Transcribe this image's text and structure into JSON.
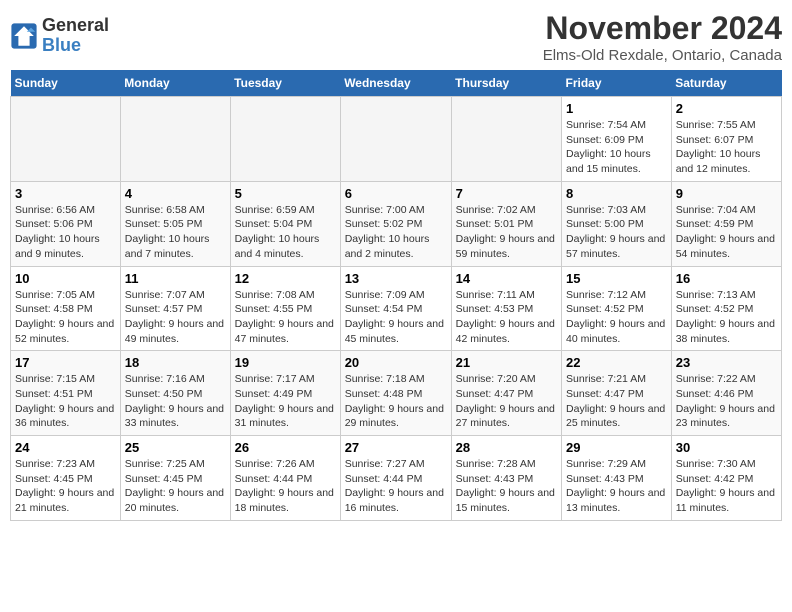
{
  "header": {
    "logo_text_general": "General",
    "logo_text_blue": "Blue",
    "month_title": "November 2024",
    "location": "Elms-Old Rexdale, Ontario, Canada"
  },
  "days_of_week": [
    "Sunday",
    "Monday",
    "Tuesday",
    "Wednesday",
    "Thursday",
    "Friday",
    "Saturday"
  ],
  "weeks": [
    [
      {
        "day": "",
        "info": ""
      },
      {
        "day": "",
        "info": ""
      },
      {
        "day": "",
        "info": ""
      },
      {
        "day": "",
        "info": ""
      },
      {
        "day": "",
        "info": ""
      },
      {
        "day": "1",
        "info": "Sunrise: 7:54 AM\nSunset: 6:09 PM\nDaylight: 10 hours and 15 minutes."
      },
      {
        "day": "2",
        "info": "Sunrise: 7:55 AM\nSunset: 6:07 PM\nDaylight: 10 hours and 12 minutes."
      }
    ],
    [
      {
        "day": "3",
        "info": "Sunrise: 6:56 AM\nSunset: 5:06 PM\nDaylight: 10 hours and 9 minutes."
      },
      {
        "day": "4",
        "info": "Sunrise: 6:58 AM\nSunset: 5:05 PM\nDaylight: 10 hours and 7 minutes."
      },
      {
        "day": "5",
        "info": "Sunrise: 6:59 AM\nSunset: 5:04 PM\nDaylight: 10 hours and 4 minutes."
      },
      {
        "day": "6",
        "info": "Sunrise: 7:00 AM\nSunset: 5:02 PM\nDaylight: 10 hours and 2 minutes."
      },
      {
        "day": "7",
        "info": "Sunrise: 7:02 AM\nSunset: 5:01 PM\nDaylight: 9 hours and 59 minutes."
      },
      {
        "day": "8",
        "info": "Sunrise: 7:03 AM\nSunset: 5:00 PM\nDaylight: 9 hours and 57 minutes."
      },
      {
        "day": "9",
        "info": "Sunrise: 7:04 AM\nSunset: 4:59 PM\nDaylight: 9 hours and 54 minutes."
      }
    ],
    [
      {
        "day": "10",
        "info": "Sunrise: 7:05 AM\nSunset: 4:58 PM\nDaylight: 9 hours and 52 minutes."
      },
      {
        "day": "11",
        "info": "Sunrise: 7:07 AM\nSunset: 4:57 PM\nDaylight: 9 hours and 49 minutes."
      },
      {
        "day": "12",
        "info": "Sunrise: 7:08 AM\nSunset: 4:55 PM\nDaylight: 9 hours and 47 minutes."
      },
      {
        "day": "13",
        "info": "Sunrise: 7:09 AM\nSunset: 4:54 PM\nDaylight: 9 hours and 45 minutes."
      },
      {
        "day": "14",
        "info": "Sunrise: 7:11 AM\nSunset: 4:53 PM\nDaylight: 9 hours and 42 minutes."
      },
      {
        "day": "15",
        "info": "Sunrise: 7:12 AM\nSunset: 4:52 PM\nDaylight: 9 hours and 40 minutes."
      },
      {
        "day": "16",
        "info": "Sunrise: 7:13 AM\nSunset: 4:52 PM\nDaylight: 9 hours and 38 minutes."
      }
    ],
    [
      {
        "day": "17",
        "info": "Sunrise: 7:15 AM\nSunset: 4:51 PM\nDaylight: 9 hours and 36 minutes."
      },
      {
        "day": "18",
        "info": "Sunrise: 7:16 AM\nSunset: 4:50 PM\nDaylight: 9 hours and 33 minutes."
      },
      {
        "day": "19",
        "info": "Sunrise: 7:17 AM\nSunset: 4:49 PM\nDaylight: 9 hours and 31 minutes."
      },
      {
        "day": "20",
        "info": "Sunrise: 7:18 AM\nSunset: 4:48 PM\nDaylight: 9 hours and 29 minutes."
      },
      {
        "day": "21",
        "info": "Sunrise: 7:20 AM\nSunset: 4:47 PM\nDaylight: 9 hours and 27 minutes."
      },
      {
        "day": "22",
        "info": "Sunrise: 7:21 AM\nSunset: 4:47 PM\nDaylight: 9 hours and 25 minutes."
      },
      {
        "day": "23",
        "info": "Sunrise: 7:22 AM\nSunset: 4:46 PM\nDaylight: 9 hours and 23 minutes."
      }
    ],
    [
      {
        "day": "24",
        "info": "Sunrise: 7:23 AM\nSunset: 4:45 PM\nDaylight: 9 hours and 21 minutes."
      },
      {
        "day": "25",
        "info": "Sunrise: 7:25 AM\nSunset: 4:45 PM\nDaylight: 9 hours and 20 minutes."
      },
      {
        "day": "26",
        "info": "Sunrise: 7:26 AM\nSunset: 4:44 PM\nDaylight: 9 hours and 18 minutes."
      },
      {
        "day": "27",
        "info": "Sunrise: 7:27 AM\nSunset: 4:44 PM\nDaylight: 9 hours and 16 minutes."
      },
      {
        "day": "28",
        "info": "Sunrise: 7:28 AM\nSunset: 4:43 PM\nDaylight: 9 hours and 15 minutes."
      },
      {
        "day": "29",
        "info": "Sunrise: 7:29 AM\nSunset: 4:43 PM\nDaylight: 9 hours and 13 minutes."
      },
      {
        "day": "30",
        "info": "Sunrise: 7:30 AM\nSunset: 4:42 PM\nDaylight: 9 hours and 11 minutes."
      }
    ]
  ]
}
